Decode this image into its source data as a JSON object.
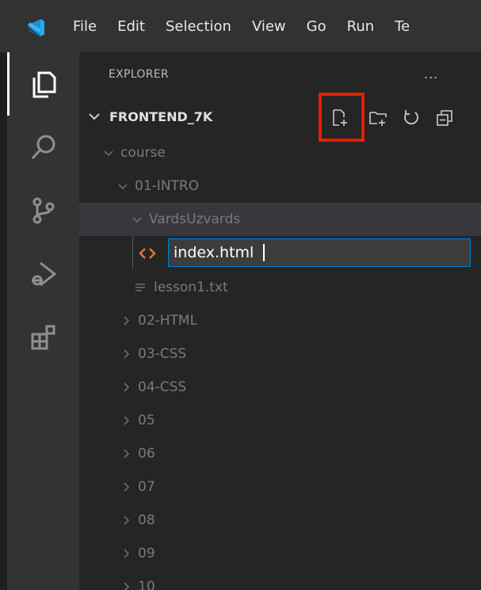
{
  "menu": [
    "File",
    "Edit",
    "Selection",
    "View",
    "Go",
    "Run",
    "Te"
  ],
  "activity_bar": [
    {
      "icon": "files-icon",
      "active": true
    },
    {
      "icon": "search-icon",
      "active": false
    },
    {
      "icon": "source-control-icon",
      "active": false
    },
    {
      "icon": "run-debug-icon",
      "active": false
    },
    {
      "icon": "extensions-icon",
      "active": false
    }
  ],
  "explorer": {
    "title": "EXPLORER",
    "more": "...",
    "project": "FRONTEND_7K",
    "actions": [
      "new-file-icon",
      "new-folder-icon",
      "refresh-icon",
      "collapse-all-icon"
    ]
  },
  "tree": [
    {
      "label": "course",
      "expanded": true
    },
    {
      "label": "01-INTRO",
      "expanded": true
    },
    {
      "label": "VardsUzvards",
      "expanded": true,
      "selected": true
    },
    {
      "label": "lesson1.txt",
      "file": true
    },
    {
      "label": "02-HTML",
      "expanded": false
    },
    {
      "label": "03-CSS",
      "expanded": false
    },
    {
      "label": "04-CSS",
      "expanded": false
    },
    {
      "label": "05",
      "expanded": false
    },
    {
      "label": "06",
      "expanded": false
    },
    {
      "label": "07",
      "expanded": false
    },
    {
      "label": "08",
      "expanded": false
    },
    {
      "label": "09",
      "expanded": false
    },
    {
      "label": "10",
      "expanded": false
    }
  ],
  "rename": {
    "value": "index.html"
  },
  "colors": {
    "highlight": "#e61e05",
    "focus_border": "#007fd4",
    "html_icon": "#e37933",
    "vscode_blue": "#23a9f2"
  }
}
